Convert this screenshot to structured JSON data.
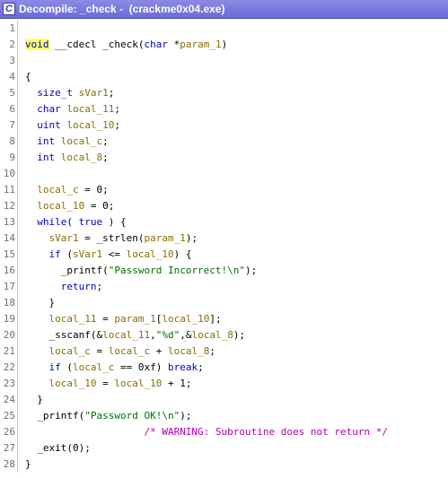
{
  "window": {
    "icon_label": "C",
    "title": "Decompile: _check -  (crackme0x04.exe)"
  },
  "code": [
    {
      "n": "1",
      "tokens": []
    },
    {
      "n": "2",
      "tokens": [
        {
          "t": "void",
          "c": "kw hl"
        },
        {
          "t": " __cdecl _check(",
          "c": "fn"
        },
        {
          "t": "char",
          "c": "kw"
        },
        {
          "t": " *",
          "c": "fn"
        },
        {
          "t": "param_1",
          "c": "var"
        },
        {
          "t": ")",
          "c": "fn"
        }
      ]
    },
    {
      "n": "3",
      "tokens": []
    },
    {
      "n": "4",
      "tokens": [
        {
          "t": "{",
          "c": "fn"
        }
      ]
    },
    {
      "n": "5",
      "tokens": [
        {
          "t": "  ",
          "c": "fn"
        },
        {
          "t": "size_t",
          "c": "kw"
        },
        {
          "t": " ",
          "c": "fn"
        },
        {
          "t": "sVar1",
          "c": "var"
        },
        {
          "t": ";",
          "c": "fn"
        }
      ]
    },
    {
      "n": "6",
      "tokens": [
        {
          "t": "  ",
          "c": "fn"
        },
        {
          "t": "char",
          "c": "kw"
        },
        {
          "t": " ",
          "c": "fn"
        },
        {
          "t": "local_11",
          "c": "var"
        },
        {
          "t": ";",
          "c": "fn"
        }
      ]
    },
    {
      "n": "7",
      "tokens": [
        {
          "t": "  ",
          "c": "fn"
        },
        {
          "t": "uint",
          "c": "kw"
        },
        {
          "t": " ",
          "c": "fn"
        },
        {
          "t": "local_10",
          "c": "var"
        },
        {
          "t": ";",
          "c": "fn"
        }
      ]
    },
    {
      "n": "8",
      "tokens": [
        {
          "t": "  ",
          "c": "fn"
        },
        {
          "t": "int",
          "c": "kw"
        },
        {
          "t": " ",
          "c": "fn"
        },
        {
          "t": "local_c",
          "c": "var"
        },
        {
          "t": ";",
          "c": "fn"
        }
      ]
    },
    {
      "n": "9",
      "tokens": [
        {
          "t": "  ",
          "c": "fn"
        },
        {
          "t": "int",
          "c": "kw"
        },
        {
          "t": " ",
          "c": "fn"
        },
        {
          "t": "local_8",
          "c": "var"
        },
        {
          "t": ";",
          "c": "fn"
        }
      ]
    },
    {
      "n": "10",
      "tokens": []
    },
    {
      "n": "11",
      "tokens": [
        {
          "t": "  ",
          "c": "fn"
        },
        {
          "t": "local_c",
          "c": "var"
        },
        {
          "t": " = 0;",
          "c": "fn"
        }
      ]
    },
    {
      "n": "12",
      "tokens": [
        {
          "t": "  ",
          "c": "fn"
        },
        {
          "t": "local_10",
          "c": "var"
        },
        {
          "t": " = 0;",
          "c": "fn"
        }
      ]
    },
    {
      "n": "13",
      "tokens": [
        {
          "t": "  ",
          "c": "fn"
        },
        {
          "t": "while",
          "c": "kw"
        },
        {
          "t": "( ",
          "c": "fn"
        },
        {
          "t": "true",
          "c": "kw"
        },
        {
          "t": " ) {",
          "c": "fn"
        }
      ]
    },
    {
      "n": "14",
      "tokens": [
        {
          "t": "    ",
          "c": "fn"
        },
        {
          "t": "sVar1",
          "c": "var"
        },
        {
          "t": " = _strlen(",
          "c": "fn"
        },
        {
          "t": "param_1",
          "c": "var"
        },
        {
          "t": ");",
          "c": "fn"
        }
      ]
    },
    {
      "n": "15",
      "tokens": [
        {
          "t": "    ",
          "c": "fn"
        },
        {
          "t": "if",
          "c": "kw"
        },
        {
          "t": " (",
          "c": "fn"
        },
        {
          "t": "sVar1",
          "c": "var"
        },
        {
          "t": " <= ",
          "c": "fn"
        },
        {
          "t": "local_10",
          "c": "var"
        },
        {
          "t": ") {",
          "c": "fn"
        }
      ]
    },
    {
      "n": "16",
      "tokens": [
        {
          "t": "      _printf(",
          "c": "fn"
        },
        {
          "t": "\"Password Incorrect!\\n\"",
          "c": "str"
        },
        {
          "t": ");",
          "c": "fn"
        }
      ]
    },
    {
      "n": "17",
      "tokens": [
        {
          "t": "      ",
          "c": "fn"
        },
        {
          "t": "return",
          "c": "kw"
        },
        {
          "t": ";",
          "c": "fn"
        }
      ]
    },
    {
      "n": "18",
      "tokens": [
        {
          "t": "    }",
          "c": "fn"
        }
      ]
    },
    {
      "n": "19",
      "tokens": [
        {
          "t": "    ",
          "c": "fn"
        },
        {
          "t": "local_11",
          "c": "var"
        },
        {
          "t": " = ",
          "c": "fn"
        },
        {
          "t": "param_1",
          "c": "var"
        },
        {
          "t": "[",
          "c": "fn"
        },
        {
          "t": "local_10",
          "c": "var"
        },
        {
          "t": "];",
          "c": "fn"
        }
      ]
    },
    {
      "n": "20",
      "tokens": [
        {
          "t": "    _sscanf(&",
          "c": "fn"
        },
        {
          "t": "local_11",
          "c": "var"
        },
        {
          "t": ",",
          "c": "fn"
        },
        {
          "t": "\"%d\"",
          "c": "str"
        },
        {
          "t": ",&",
          "c": "fn"
        },
        {
          "t": "local_8",
          "c": "var"
        },
        {
          "t": ");",
          "c": "fn"
        }
      ]
    },
    {
      "n": "21",
      "tokens": [
        {
          "t": "    ",
          "c": "fn"
        },
        {
          "t": "local_c",
          "c": "var"
        },
        {
          "t": " = ",
          "c": "fn"
        },
        {
          "t": "local_c",
          "c": "var"
        },
        {
          "t": " + ",
          "c": "fn"
        },
        {
          "t": "local_8",
          "c": "var"
        },
        {
          "t": ";",
          "c": "fn"
        }
      ]
    },
    {
      "n": "22",
      "tokens": [
        {
          "t": "    ",
          "c": "fn"
        },
        {
          "t": "if",
          "c": "kw"
        },
        {
          "t": " (",
          "c": "fn"
        },
        {
          "t": "local_c",
          "c": "var"
        },
        {
          "t": " == 0xf) ",
          "c": "fn"
        },
        {
          "t": "break",
          "c": "kw"
        },
        {
          "t": ";",
          "c": "fn"
        }
      ]
    },
    {
      "n": "23",
      "tokens": [
        {
          "t": "    ",
          "c": "fn"
        },
        {
          "t": "local_10",
          "c": "var"
        },
        {
          "t": " = ",
          "c": "fn"
        },
        {
          "t": "local_10",
          "c": "var"
        },
        {
          "t": " + 1;",
          "c": "fn"
        }
      ]
    },
    {
      "n": "24",
      "tokens": [
        {
          "t": "  }",
          "c": "fn"
        }
      ]
    },
    {
      "n": "25",
      "tokens": [
        {
          "t": "  _printf(",
          "c": "fn"
        },
        {
          "t": "\"Password OK!\\n\"",
          "c": "str"
        },
        {
          "t": ");",
          "c": "fn"
        }
      ]
    },
    {
      "n": "26",
      "tokens": [
        {
          "t": "                    ",
          "c": "fn"
        },
        {
          "t": "/* WARNING: Subroutine does not return */",
          "c": "cmt"
        }
      ]
    },
    {
      "n": "27",
      "tokens": [
        {
          "t": "  _exit(0);",
          "c": "fn"
        }
      ]
    },
    {
      "n": "28",
      "tokens": [
        {
          "t": "}",
          "c": "fn"
        }
      ]
    }
  ],
  "colors": {
    "titlebar": "#7a7ae0",
    "keyword": "#0000c8",
    "variable": "#8a6d00",
    "string": "#007000",
    "comment": "#b000b0",
    "highlight": "#ffff66"
  }
}
